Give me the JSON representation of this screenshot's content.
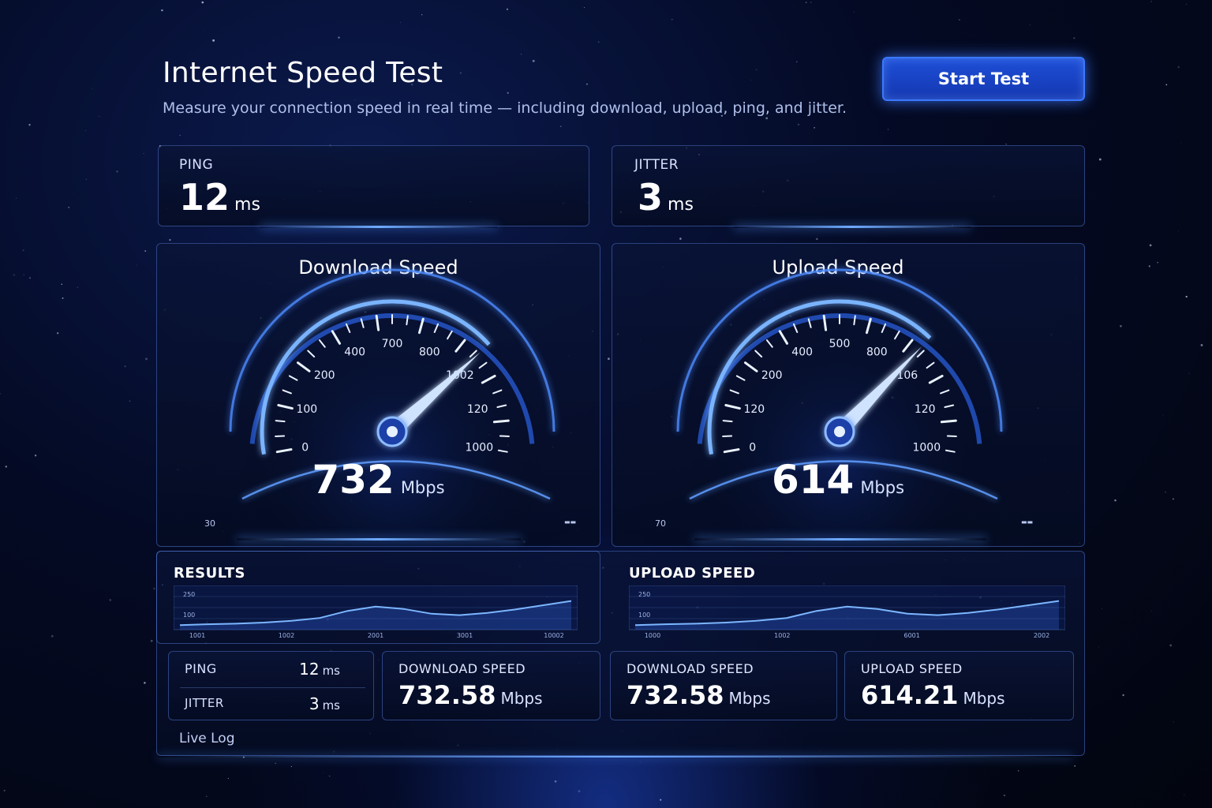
{
  "header": {
    "title": "Internet Speed Test",
    "subtitle": "Measure your connection speed in real time — including download, upload, ping, and jitter.",
    "start_label": "Start Test"
  },
  "stats": {
    "ping": {
      "label": "PING",
      "value": "12",
      "unit": "ms"
    },
    "jitter": {
      "label": "JITTER",
      "value": "3",
      "unit": "ms"
    }
  },
  "download_gauge": {
    "title": "Download Speed",
    "value": "732",
    "unit": "Mbps",
    "needle_fraction": 0.74,
    "ticks": [
      "0",
      "100",
      "200",
      "400",
      "700",
      "800",
      "1002",
      "120",
      "1000"
    ],
    "corner_left": "30",
    "corner_right": "▬▬"
  },
  "upload_gauge": {
    "title": "Upload Speed",
    "value": "614",
    "unit": "Mbps",
    "needle_fraction": 0.72,
    "ticks": [
      "0",
      "120",
      "200",
      "400",
      "500",
      "800",
      "106",
      "120",
      "1000"
    ],
    "corner_left": "70",
    "corner_right": "▬▬"
  },
  "results_section": {
    "label": "RESULTS",
    "y_ticks": [
      "250",
      "100"
    ],
    "x_ticks": [
      "1001",
      "1002",
      "2001",
      "3001",
      "10002"
    ]
  },
  "upload_section": {
    "label": "UPLOAD SPEED",
    "y_ticks": [
      "250",
      "100"
    ],
    "x_ticks": [
      "1000",
      "1002",
      "6001",
      "2002"
    ]
  },
  "summary": {
    "ping_label": "PING",
    "ping_value": "12",
    "ping_unit": "ms",
    "jitter_label": "JITTER",
    "jitter_value": "3",
    "jitter_unit": "ms",
    "download1": {
      "label": "DOWNLOAD SPEED",
      "value": "732.58",
      "unit": "Mbps"
    },
    "download2": {
      "label": "DOWNLOAD SPEED",
      "value": "732.58",
      "unit": "Mbps"
    },
    "upload": {
      "label": "UPLOAD SPEED",
      "value": "614.21",
      "unit": "Mbps"
    }
  },
  "footer": {
    "live_log_label": "Live Log"
  },
  "colors": {
    "accent": "#3a78ff",
    "glow": "#6fa8ff",
    "background": "#040a24"
  }
}
